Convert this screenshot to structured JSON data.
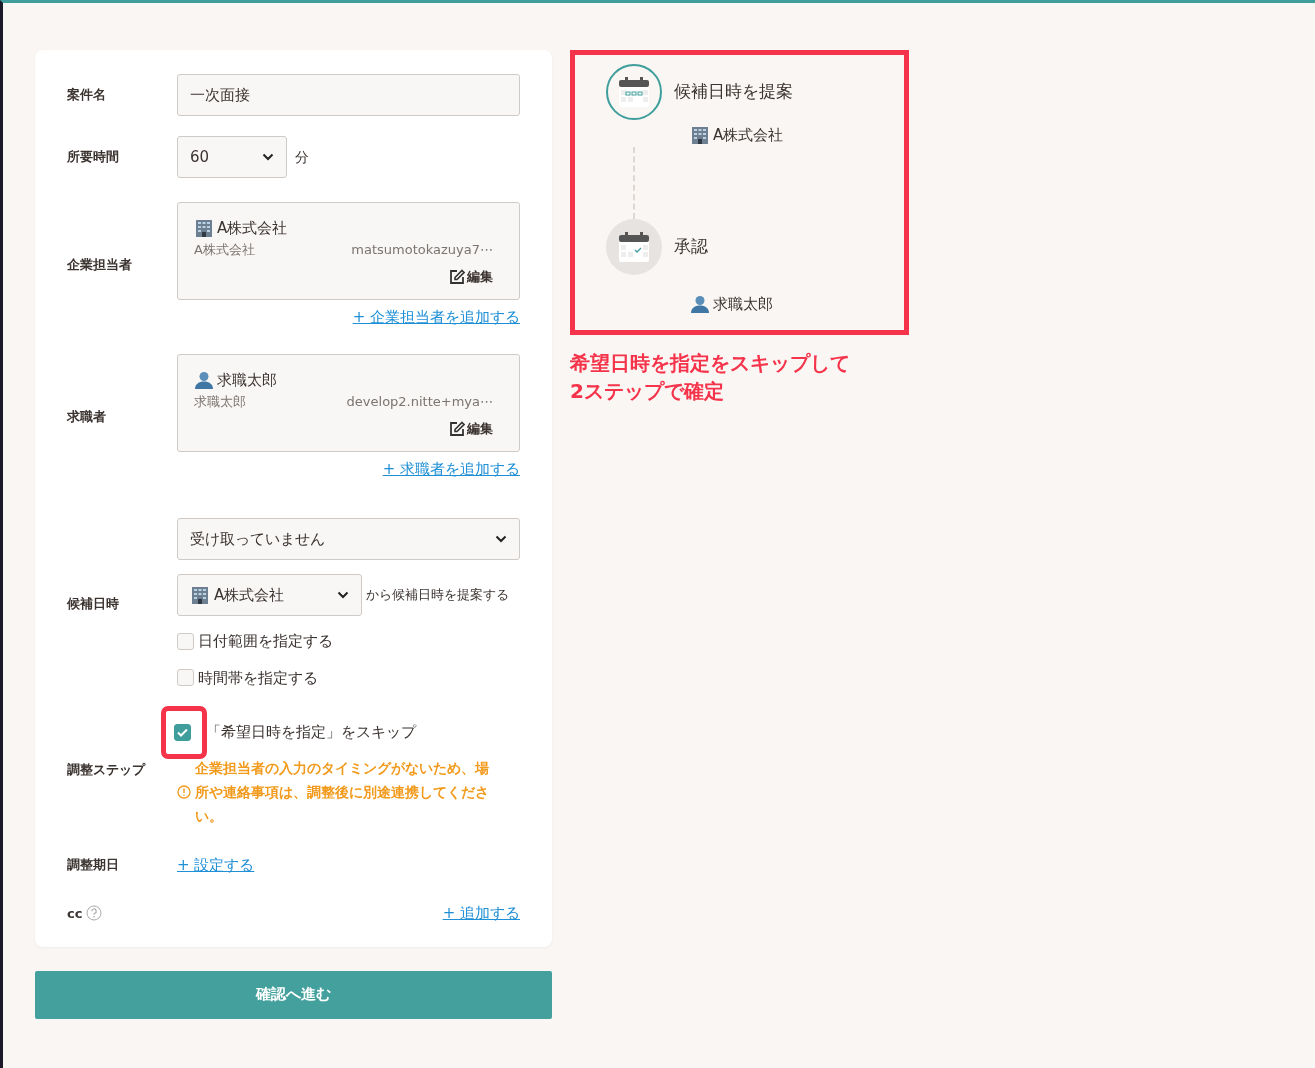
{
  "form": {
    "fields": [
      {
        "kind": "text",
        "label": "案件名",
        "value": "一次面接"
      },
      {
        "kind": "duration",
        "label": "所要時間",
        "value": "60",
        "unit": "分"
      },
      {
        "kind": "people",
        "label": "企業担当者",
        "name": "A株式会社",
        "sub": "A株式会社",
        "email": "matsumotokazuya7⋯",
        "edit": "編集",
        "add_link": "+ 企業担当者を追加する"
      },
      {
        "kind": "people",
        "label": "求職者",
        "name": "求職太郎",
        "sub": "求職太郎",
        "email": "develop2.nitte+mya⋯",
        "edit": "編集",
        "add_link": "+ 求職者を追加する"
      },
      {
        "kind": "candidates",
        "label": "候補日時",
        "status": "受け取っていません",
        "proposer": "A株式会社",
        "proposer_suffix": "から候補日時を提案する",
        "options": [
          {
            "label": "日付範囲を指定する",
            "checked": false
          },
          {
            "label": "時間帯を指定する",
            "checked": false
          }
        ]
      },
      {
        "kind": "steps",
        "label": "調整ステップ",
        "option": {
          "label": "「希望日時を指定」をスキップ",
          "checked": true,
          "highlighted": true
        },
        "warning": "企業担当者の入力のタイミングがないため、場所や連絡事項は、調整後に別途連携してください。"
      },
      {
        "kind": "link",
        "label": "調整期日",
        "link": "+ 設定する"
      },
      {
        "kind": "cc",
        "label": "cc",
        "link": "+ 追加する"
      }
    ]
  },
  "submit": "確認へ進む",
  "flow": {
    "highlighted": true,
    "steps": [
      {
        "title": "候補日時を提案",
        "actor": "A株式会社",
        "active": true
      },
      {
        "title": "承認",
        "actor": "求職太郎",
        "active": false
      }
    ]
  },
  "annotation": "希望日時を指定をスキップして\n2ステップで確定"
}
